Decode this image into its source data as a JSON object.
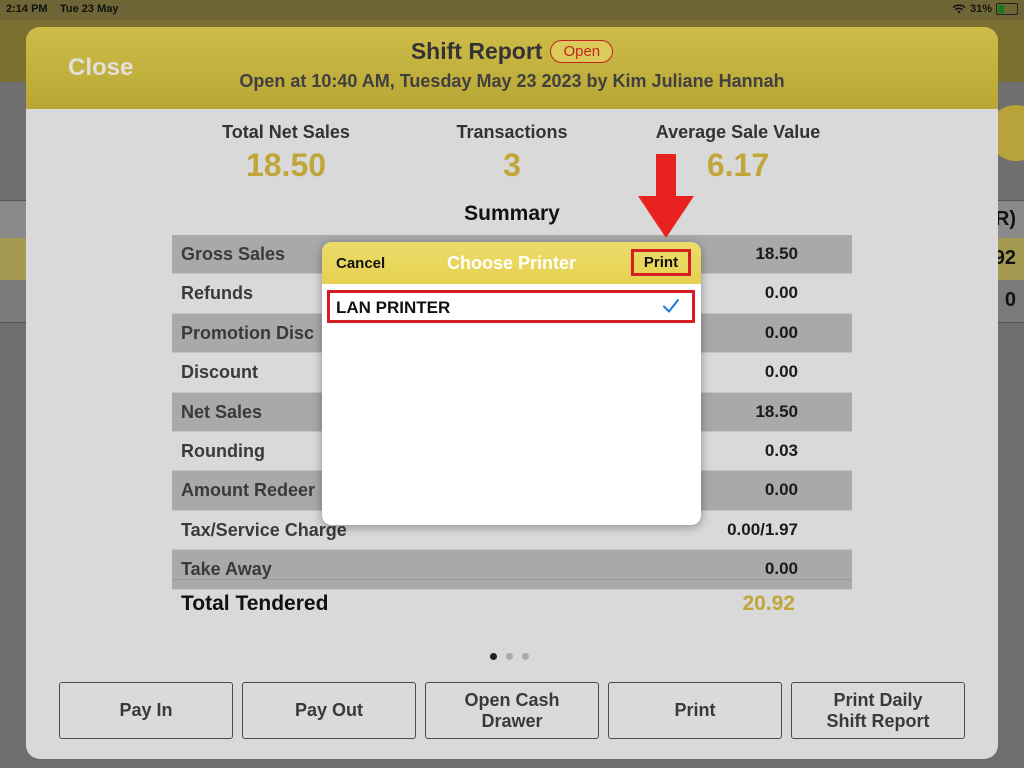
{
  "status_bar": {
    "time": "2:14 PM",
    "date": "Tue 23 May",
    "battery": "31%",
    "battery_level": 0.31
  },
  "background": {
    "header_partial": "R)",
    "row1_partial": "92",
    "row2_partial": "0"
  },
  "shift_report": {
    "close_label": "Close",
    "title": "Shift Report",
    "status_badge": "Open",
    "subtitle": "Open at 10:40 AM, Tuesday May 23 2023 by Kim Juliane Hannah",
    "stats": [
      {
        "label": "Total Net Sales",
        "value": "18.50"
      },
      {
        "label": "Transactions",
        "value": "3"
      },
      {
        "label": "Average Sale Value",
        "value": "6.17"
      }
    ],
    "summary_title": "Summary",
    "rows": [
      {
        "name": "Gross Sales",
        "amount": "18.50"
      },
      {
        "name": "Refunds",
        "amount": "0.00"
      },
      {
        "name": "Promotion Disc",
        "amount": "0.00"
      },
      {
        "name": "Discount",
        "amount": "0.00"
      },
      {
        "name": "Net Sales",
        "amount": "18.50"
      },
      {
        "name": "Rounding",
        "amount": "0.03"
      },
      {
        "name": "Amount Redeer",
        "amount": "0.00"
      },
      {
        "name": "Tax/Service Charge",
        "amount": "0.00/1.97"
      },
      {
        "name": "Take Away",
        "amount": "0.00"
      }
    ],
    "total_label": "Total Tendered",
    "total_value": "20.92",
    "page_indicator": {
      "count": 3,
      "current": 1
    },
    "buttons": {
      "pay_in": "Pay In",
      "pay_out": "Pay Out",
      "open_cash_drawer": "Open Cash\nDrawer",
      "print": "Print",
      "print_daily": "Print Daily\nShift Report"
    }
  },
  "choose_printer": {
    "cancel_label": "Cancel",
    "title": "Choose Printer",
    "print_label": "Print",
    "printers": [
      {
        "name": "LAN PRINTER",
        "selected": true
      }
    ]
  },
  "colors": {
    "accent": "#c1a63a",
    "header": "#cfbd4a",
    "highlight": "#d61e26",
    "check": "#1a7ae0"
  }
}
